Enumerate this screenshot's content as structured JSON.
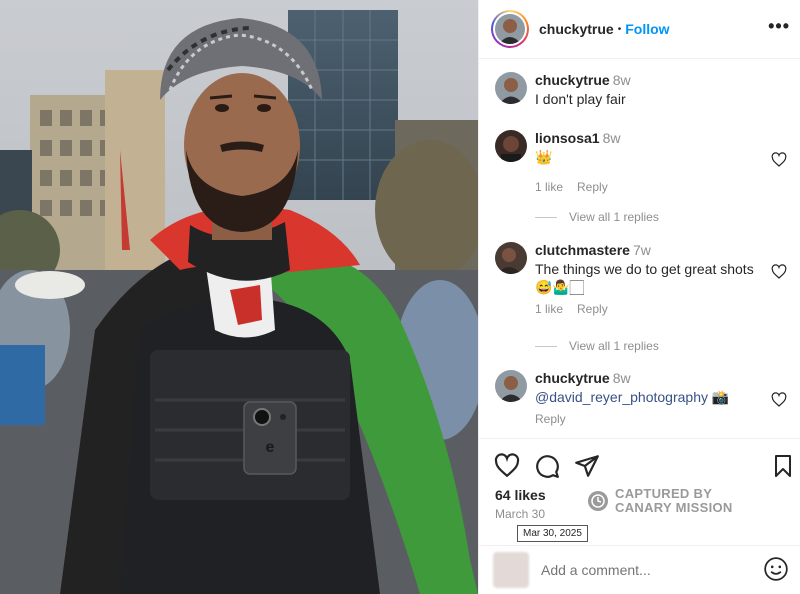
{
  "post": {
    "username": "chuckytrue",
    "follow_label": "Follow",
    "separator": "•",
    "more_label": "•••"
  },
  "comments": [
    {
      "username": "chuckytrue",
      "time": "8w",
      "text": "I don't play fair"
    },
    {
      "username": "lionsosa1",
      "time": "8w",
      "text": "👑",
      "likes": "1 like",
      "reply": "Reply",
      "view_replies": "View all 1 replies"
    },
    {
      "username": "clutchmastere",
      "time": "7w",
      "text": "The things we do to get great shots 😅🤷‍♂️🏻",
      "likes": "1 like",
      "reply": "Reply",
      "view_replies": "View all 1 replies"
    },
    {
      "username": "chuckytrue",
      "time": "8w",
      "mention": "@david_reyer_photography",
      "suffix": " 📸",
      "reply": "Reply"
    }
  ],
  "footer": {
    "likes": "64 likes",
    "date": "March 30",
    "tooltip": "Mar 30, 2025",
    "watermark_line1": "CAPTURED BY",
    "watermark_line2": "CANARY MISSION",
    "add_comment_placeholder": "Add a comment..."
  },
  "icons": {
    "like": "heart-icon",
    "comment": "comment-bubble-icon",
    "share": "paper-plane-icon",
    "save": "bookmark-icon",
    "emoji": "smiley-icon",
    "more": "more-options-icon"
  },
  "colors": {
    "follow": "#0095f6",
    "muted": "#8e8e8e",
    "link": "#385185",
    "flag_red": "#d9362e",
    "flag_green": "#3f9a3b"
  }
}
